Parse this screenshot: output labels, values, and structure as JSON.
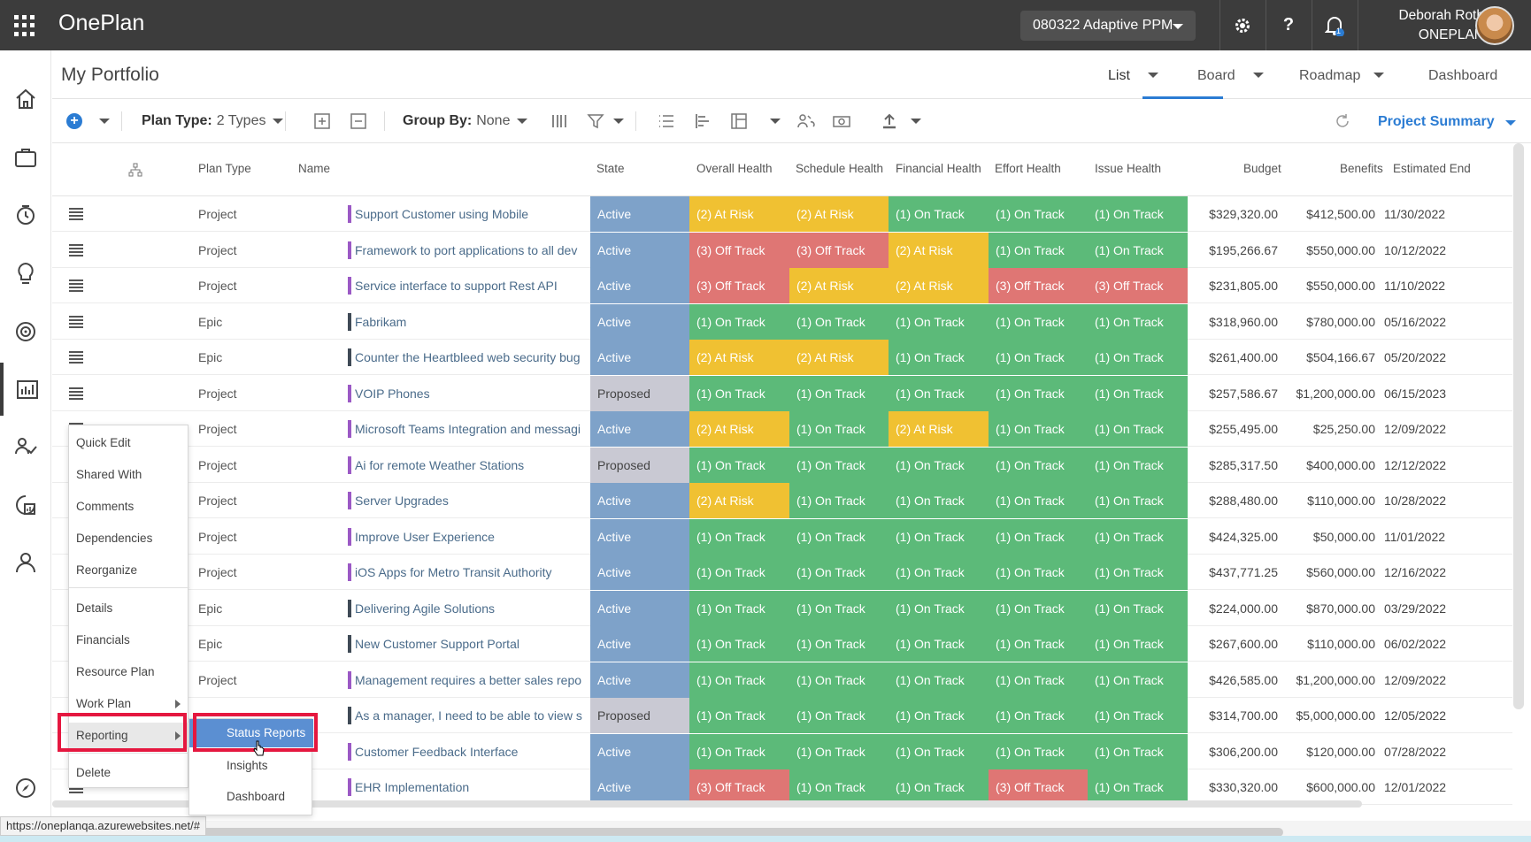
{
  "app": {
    "brand": "OnePlan",
    "workspace": "080322 Adaptive PPM",
    "user_name": "Deborah Roth",
    "user_org": "ONEPLAN",
    "notification_count": "1"
  },
  "page": {
    "title": "My Portfolio",
    "tabs": [
      {
        "label": "List"
      },
      {
        "label": "Board"
      },
      {
        "label": "Roadmap"
      },
      {
        "label": "Dashboard"
      }
    ]
  },
  "toolbar": {
    "plan_type_label": "Plan Type:",
    "plan_type_value": "2 Types",
    "group_by_label": "Group By:",
    "group_by_value": "None",
    "view_selector": "Project Summary"
  },
  "grid": {
    "columns": [
      "Plan Type",
      "Name",
      "State",
      "Overall Health",
      "Schedule Health",
      "Financial Health",
      "Effort Health",
      "Issue Health",
      "Budget",
      "Benefits",
      "Estimated End"
    ],
    "rows": [
      {
        "type": "Project",
        "name": "Support Customer using Mobile",
        "state": "Active",
        "overall": "(2) At Risk",
        "schedule": "(2) At Risk",
        "financial": "(1) On Track",
        "effort": "(1) On Track",
        "issue": "(1) On Track",
        "budget": "$329,320.00",
        "benefits": "$412,500.00",
        "end": "11/30/2022"
      },
      {
        "type": "Project",
        "name": "Framework to port applications to all dev",
        "state": "Active",
        "overall": "(3) Off Track",
        "schedule": "(3) Off Track",
        "financial": "(2) At Risk",
        "effort": "(1) On Track",
        "issue": "(1) On Track",
        "budget": "$195,266.67",
        "benefits": "$550,000.00",
        "end": "10/12/2022"
      },
      {
        "type": "Project",
        "name": "Service interface to support Rest API",
        "state": "Active",
        "overall": "(3) Off Track",
        "schedule": "(2) At Risk",
        "financial": "(2) At Risk",
        "effort": "(3) Off Track",
        "issue": "(3) Off Track",
        "budget": "$231,805.00",
        "benefits": "$550,000.00",
        "end": "11/10/2022"
      },
      {
        "type": "Epic",
        "name": "Fabrikam",
        "state": "Active",
        "overall": "(1) On Track",
        "schedule": "(1) On Track",
        "financial": "(1) On Track",
        "effort": "(1) On Track",
        "issue": "(1) On Track",
        "budget": "$318,960.00",
        "benefits": "$780,000.00",
        "end": "05/16/2022"
      },
      {
        "type": "Epic",
        "name": "Counter the Heartbleed web security bug",
        "state": "Active",
        "overall": "(2) At Risk",
        "schedule": "(2) At Risk",
        "financial": "(1) On Track",
        "effort": "(1) On Track",
        "issue": "(1) On Track",
        "budget": "$261,400.00",
        "benefits": "$504,166.67",
        "end": "05/20/2022"
      },
      {
        "type": "Project",
        "name": "VOIP Phones",
        "state": "Proposed",
        "overall": "(1) On Track",
        "schedule": "(1) On Track",
        "financial": "(1) On Track",
        "effort": "(1) On Track",
        "issue": "(1) On Track",
        "budget": "$257,586.67",
        "benefits": "$1,200,000.00",
        "end": "06/15/2023"
      },
      {
        "type": "Project",
        "name": "Microsoft Teams Integration and messagi",
        "state": "Active",
        "overall": "(2) At Risk",
        "schedule": "(1) On Track",
        "financial": "(2) At Risk",
        "effort": "(1) On Track",
        "issue": "(1) On Track",
        "budget": "$255,495.00",
        "benefits": "$25,250.00",
        "end": "12/09/2022"
      },
      {
        "type": "Project",
        "name": "Ai for remote Weather Stations",
        "state": "Proposed",
        "overall": "(1) On Track",
        "schedule": "(1) On Track",
        "financial": "(1) On Track",
        "effort": "(1) On Track",
        "issue": "(1) On Track",
        "budget": "$285,317.50",
        "benefits": "$400,000.00",
        "end": "12/12/2022"
      },
      {
        "type": "Project",
        "name": "Server Upgrades",
        "state": "Active",
        "overall": "(2) At Risk",
        "schedule": "(1) On Track",
        "financial": "(1) On Track",
        "effort": "(1) On Track",
        "issue": "(1) On Track",
        "budget": "$288,480.00",
        "benefits": "$110,000.00",
        "end": "10/28/2022"
      },
      {
        "type": "Project",
        "name": "Improve User Experience",
        "state": "Active",
        "overall": "(1) On Track",
        "schedule": "(1) On Track",
        "financial": "(1) On Track",
        "effort": "(1) On Track",
        "issue": "(1) On Track",
        "budget": "$424,325.00",
        "benefits": "$50,000.00",
        "end": "11/01/2022"
      },
      {
        "type": "Project",
        "name": "iOS Apps for Metro Transit Authority",
        "state": "Active",
        "overall": "(1) On Track",
        "schedule": "(1) On Track",
        "financial": "(1) On Track",
        "effort": "(1) On Track",
        "issue": "(1) On Track",
        "budget": "$437,771.25",
        "benefits": "$560,000.00",
        "end": "12/16/2022"
      },
      {
        "type": "Epic",
        "name": "Delivering Agile Solutions",
        "state": "Active",
        "overall": "(1) On Track",
        "schedule": "(1) On Track",
        "financial": "(1) On Track",
        "effort": "(1) On Track",
        "issue": "(1) On Track",
        "budget": "$224,000.00",
        "benefits": "$870,000.00",
        "end": "03/29/2022"
      },
      {
        "type": "Epic",
        "name": "New Customer Support Portal",
        "state": "Active",
        "overall": "(1) On Track",
        "schedule": "(1) On Track",
        "financial": "(1) On Track",
        "effort": "(1) On Track",
        "issue": "(1) On Track",
        "budget": "$267,600.00",
        "benefits": "$110,000.00",
        "end": "06/02/2022"
      },
      {
        "type": "Project",
        "name": "Management requires a better sales repo",
        "state": "Active",
        "overall": "(1) On Track",
        "schedule": "(1) On Track",
        "financial": "(1) On Track",
        "effort": "(1) On Track",
        "issue": "(1) On Track",
        "budget": "$426,585.00",
        "benefits": "$1,200,000.00",
        "end": "12/09/2022"
      },
      {
        "type": "",
        "name": "As a manager, I need to be able to view s",
        "state": "Proposed",
        "overall": "(1) On Track",
        "schedule": "(1) On Track",
        "financial": "(1) On Track",
        "effort": "(1) On Track",
        "issue": "(1) On Track",
        "budget": "$314,700.00",
        "benefits": "$5,000,000.00",
        "end": "12/05/2022"
      },
      {
        "type": "",
        "name": "Customer Feedback Interface",
        "state": "Active",
        "overall": "(1) On Track",
        "schedule": "(1) On Track",
        "financial": "(1) On Track",
        "effort": "(1) On Track",
        "issue": "(1) On Track",
        "budget": "$306,200.00",
        "benefits": "$120,000.00",
        "end": "07/28/2022"
      },
      {
        "type": "",
        "name": "EHR Implementation",
        "state": "Active",
        "overall": "(3) Off Track",
        "schedule": "(1) On Track",
        "financial": "(1) On Track",
        "effort": "(3) Off Track",
        "issue": "(1) On Track",
        "budget": "$330,320.00",
        "benefits": "$600,000.00",
        "end": "12/01/2022"
      }
    ]
  },
  "context_menu": {
    "items": [
      "Quick Edit",
      "Shared With",
      "Comments",
      "Dependencies",
      "Reorganize",
      "Details",
      "Financials",
      "Resource Plan",
      "Work Plan",
      "Reporting",
      "Delete"
    ],
    "submenu": [
      "Status Reports",
      "Insights",
      "Dashboard"
    ]
  },
  "status_bar": {
    "url": "https://oneplanqa.azurewebsites.net/#"
  },
  "colors": {
    "Active": "#7ea2c9",
    "Proposed": "#c9c9d3",
    "(1) On Track": "#5cba79",
    "(2) At Risk": "#f0c132",
    "(3) Off Track": "#df7674",
    "Project": "#9b59c5",
    "Epic": "#3f4a56",
    "accent": "#2b7cd3",
    "highlight_box": "#e5173f"
  }
}
